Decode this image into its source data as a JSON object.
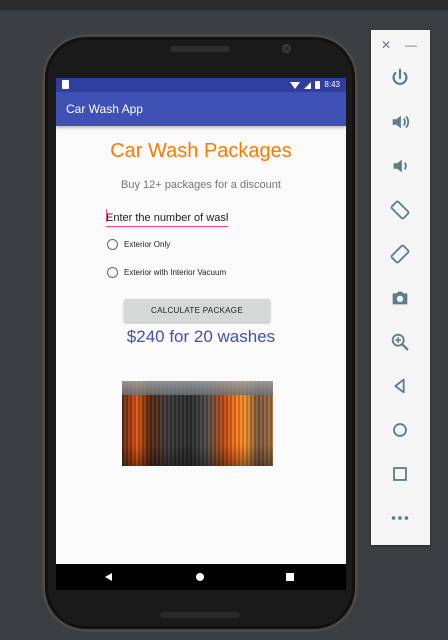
{
  "app": {
    "title": "Car Wash App",
    "status_time": "8:43"
  },
  "main": {
    "heading": "Car Wash Packages",
    "subheading": "Buy 12+ packages for a discount",
    "input_placeholder": "Enter the number of wash",
    "radio_options": [
      "Exterior Only",
      "Exterior with Interior Vacuum"
    ],
    "button_label": "CALCULATE PACKAGE",
    "result": "$240 for 20 washes"
  },
  "colors": {
    "status_bar": "#303f9f",
    "app_bar": "#3f51b5",
    "heading": "#f57c00",
    "result": "#3f51b5",
    "accent": "#ff4081"
  },
  "emulator_panel": {
    "controls": [
      "close-icon",
      "minimize-icon"
    ],
    "icons": [
      "power-icon",
      "volume-up-icon",
      "volume-down-icon",
      "rotate-left-icon",
      "rotate-right-icon",
      "camera-icon",
      "zoom-icon",
      "back-icon",
      "home-icon",
      "overview-icon",
      "more-icon"
    ]
  },
  "nav": {
    "buttons": [
      "back",
      "home",
      "recents"
    ]
  }
}
